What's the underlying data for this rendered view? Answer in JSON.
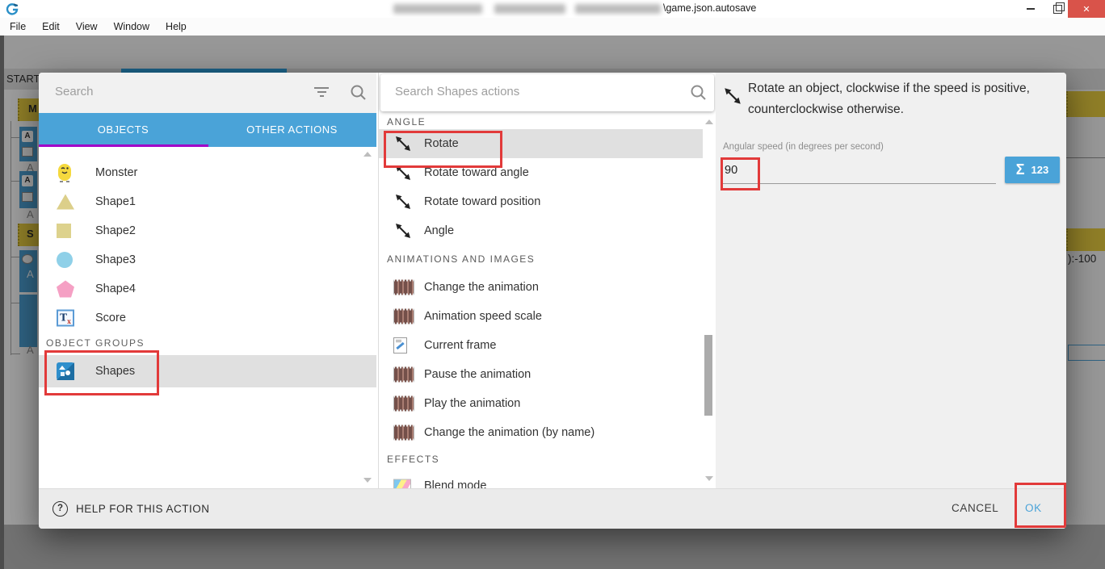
{
  "window": {
    "title_visible": "\\game.json.autosave",
    "close_glyph": "✕"
  },
  "menu": {
    "items": [
      "File",
      "Edit",
      "View",
      "Window",
      "Help"
    ]
  },
  "toolbar": {
    "left_icons": [
      "events-list-icon",
      "scene-editor-icon"
    ],
    "right_icons": [
      "play-icon",
      "debug-icon",
      "add-event-icon",
      "add-subevent-icon",
      "add-comment-icon",
      "add-circle-icon",
      "delete-event-icon",
      "undo-icon",
      "redo-icon",
      "search-icon"
    ]
  },
  "background": {
    "tab_label": "START",
    "comment_m": "M",
    "comment_s": "S",
    "letter_a": "A",
    "right_text": "):-100"
  },
  "dialog": {
    "left_panel": {
      "search_placeholder": "Search",
      "tabs": [
        {
          "label": "OBJECTS",
          "active": true
        },
        {
          "label": "OTHER ACTIONS",
          "active": false
        }
      ],
      "objects": [
        "Monster",
        "Shape1",
        "Shape2",
        "Shape3",
        "Shape4",
        "Score"
      ],
      "score_glyph": "T",
      "score_sub": "x",
      "groups_header": "OBJECT GROUPS",
      "groups": [
        "Shapes"
      ]
    },
    "actions_panel": {
      "search_placeholder": "Search Shapes actions",
      "sections": [
        {
          "header": "ANGLE",
          "items": [
            "Rotate",
            "Rotate toward angle",
            "Rotate toward position",
            "Angle"
          ]
        },
        {
          "header": "ANIMATIONS AND IMAGES",
          "items": [
            "Change the animation",
            "Animation speed scale",
            "Current frame",
            "Pause the animation",
            "Play the animation",
            "Change the animation (by name)"
          ]
        },
        {
          "header": "EFFECTS",
          "items": [
            "Blend mode"
          ]
        }
      ],
      "selected_item": "Rotate"
    },
    "detail_panel": {
      "description": "Rotate an object, clockwise if the speed is positive, counterclockwise otherwise.",
      "field_label": "Angular speed (in degrees per second)",
      "field_value": "90",
      "expression_button": {
        "sigma": "Σ",
        "label": "123"
      }
    },
    "footer": {
      "help_label": "HELP FOR THIS ACTION",
      "cancel_label": "CANCEL",
      "ok_label": "OK"
    }
  },
  "colors": {
    "accent_blue": "#4aa3d8",
    "tab_underline_purple": "#a000c8",
    "annotation_red": "#e23a3a",
    "selected_gray": "#e0e0e0",
    "close_red": "#d9534a",
    "event_comment_yellow": "#e0c63e",
    "event_blue": "#4a9bce"
  }
}
